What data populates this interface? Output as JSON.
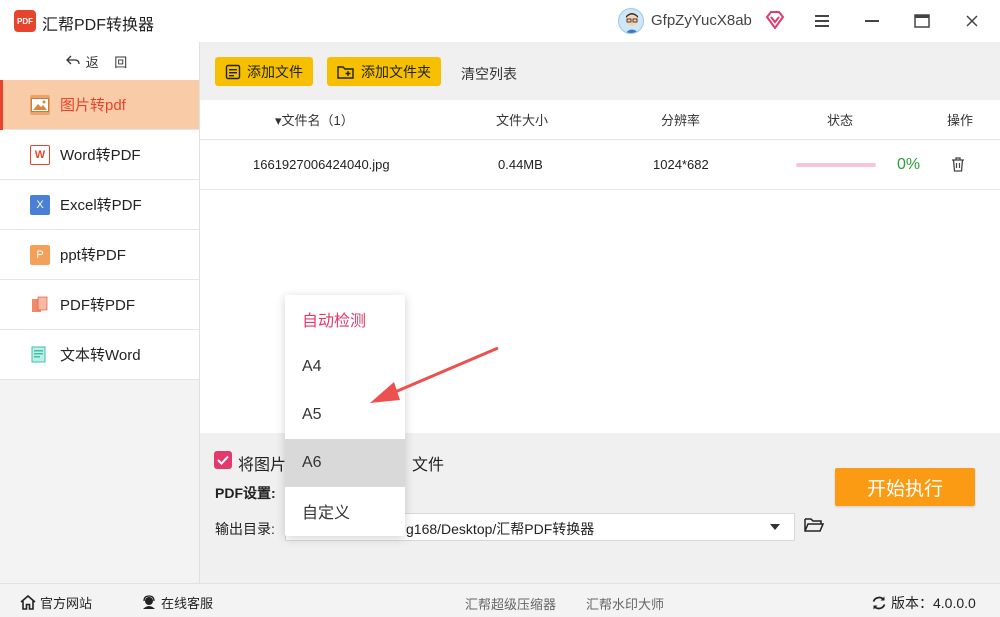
{
  "app": {
    "title": "汇帮PDF转换器",
    "logo_text": "PDF",
    "username": "GfpZyYucX8ab"
  },
  "sidebar": {
    "back_label": "返 回",
    "items": [
      {
        "label": "图片转pdf",
        "icon": "image-icon",
        "active": true
      },
      {
        "label": "Word转PDF",
        "icon": "word-icon"
      },
      {
        "label": "Excel转PDF",
        "icon": "excel-icon"
      },
      {
        "label": "ppt转PDF",
        "icon": "ppt-icon"
      },
      {
        "label": "PDF转PDF",
        "icon": "pdf-icon"
      },
      {
        "label": "文本转Word",
        "icon": "text-icon"
      }
    ]
  },
  "toolbar": {
    "add_file": "添加文件",
    "add_folder": "添加文件夹",
    "clear_list": "清空列表"
  },
  "table": {
    "headers": {
      "name": "▾文件名（1）",
      "size": "文件大小",
      "resolution": "分辨率",
      "status": "状态",
      "action": "操作"
    },
    "rows": [
      {
        "name": "1661927006424040.jpg",
        "size": "0.44MB",
        "resolution": "1024*682",
        "progress": "0%",
        "progress_value": 0
      }
    ]
  },
  "settings": {
    "merge_left": "将图片",
    "merge_right": "文件",
    "merge_checked": true,
    "pdf_settings_label": "PDF设置:",
    "output_label": "输出目录:",
    "output_path": "g168/Desktop/汇帮PDF转换器",
    "start_button": "开始执行"
  },
  "dropdown": {
    "options": [
      "自动检测",
      "A4",
      "A5",
      "A6",
      "自定义"
    ],
    "selected": "自动检测",
    "hovered": "A6"
  },
  "footer": {
    "website": "官方网站",
    "support": "在线客服",
    "link1": "汇帮超级压缩器",
    "link2": "汇帮水印大师",
    "version": "版本：4.0.0.0"
  },
  "colors": {
    "accent_orange": "#fb9a13",
    "accent_yellow": "#f6c000",
    "active_red": "#e8432c",
    "active_bg": "#f9cba6",
    "checkbox_pink": "#e23a6c",
    "progress_green": "#2e9c3a"
  }
}
